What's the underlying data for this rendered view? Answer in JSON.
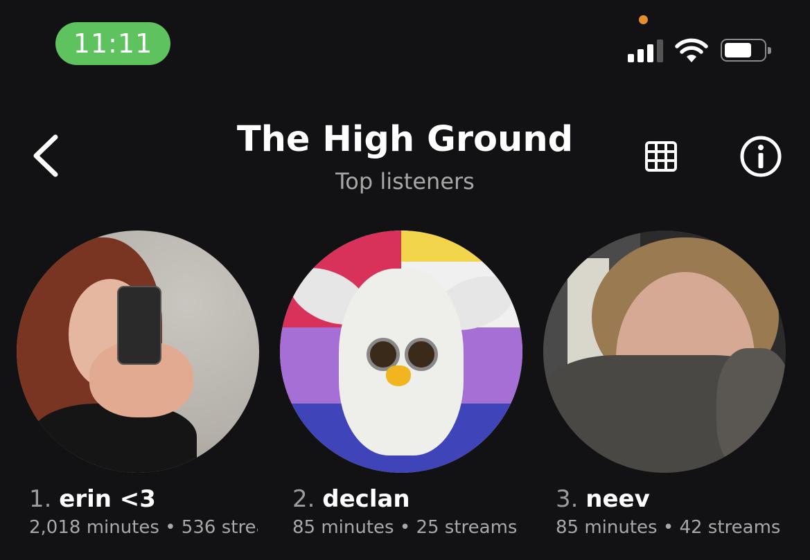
{
  "status_bar": {
    "time": "11:11"
  },
  "header": {
    "title": "The High Ground",
    "subtitle": "Top listeners"
  },
  "listeners": [
    {
      "rank": "1.",
      "name": "erin <3",
      "stats": "2,018 minutes • 536 strea"
    },
    {
      "rank": "2.",
      "name": "declan",
      "stats": "85 minutes • 25 streams"
    },
    {
      "rank": "3.",
      "name": "neev",
      "stats": "85 minutes • 42 streams"
    }
  ],
  "colors": {
    "background": "#121214",
    "time_pill": "#5ec25e",
    "privacy_dot": "#e58e2d",
    "secondary_text": "#a8a8a8"
  },
  "icons": [
    "back-chevron-icon",
    "grid-icon",
    "info-icon",
    "signal-icon",
    "wifi-icon",
    "battery-icon"
  ]
}
